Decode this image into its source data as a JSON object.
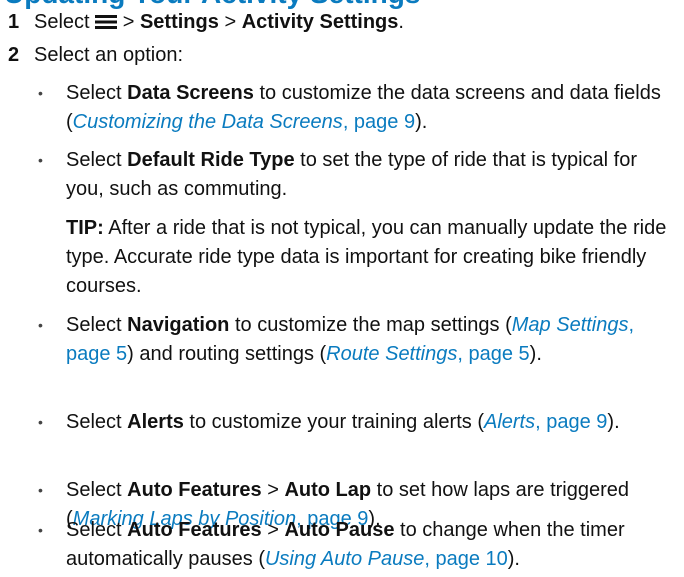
{
  "heading": "Updating Your Activity Settings",
  "step1": {
    "num": "1",
    "pre": "Select",
    "icon": "menu-icon",
    "sep1": ">",
    "settings": "Settings",
    "sep2": ">",
    "activity_settings": "Activity Settings",
    "end": "."
  },
  "step2": {
    "num": "2",
    "text": "Select an option:"
  },
  "bullets": {
    "data_screens": {
      "pre": "Select",
      "term": "Data Screens",
      "mid": "to customize the data screens and data fields (",
      "link_title": "Customizing the Data Screens",
      "link_page": ", page 9",
      "end": ")."
    },
    "ride_type": {
      "pre": "Select",
      "term": "Default Ride Type",
      "mid": "to set the type of ride that is typical for you, such as commuting."
    },
    "tip": {
      "label": "TIP:",
      "text": "After a ride that is not typical, you can manually update the ride type. Accurate ride type data is important for creating bike friendly courses."
    },
    "navigation": {
      "pre": "Select",
      "term": "Navigation",
      "mid": "to customize the map settings (",
      "link1_title": "Map Settings",
      "link1_page": ", page 5",
      "mid2": ") and routing settings (",
      "link2_title": "Route Settings",
      "link2_page": ", page 5",
      "end": ")."
    },
    "alerts": {
      "pre": "Select",
      "term": "Alerts",
      "mid": "to customize your training alerts (",
      "link_title": "Alerts",
      "link_page": ", page 9",
      "end": ")."
    },
    "auto_lap": {
      "pre": "Select",
      "term1": "Auto Features",
      "sep": ">",
      "term2": "Auto Lap",
      "mid": "to set how laps are triggered (",
      "link_title": "Marking Laps by Position",
      "link_page": ", page 9",
      "end": ")."
    },
    "auto_pause": {
      "pre": "Select",
      "term1": "Auto Features",
      "sep": ">",
      "term2": "Auto Pause",
      "mid": "to change when the timer automatically pauses (",
      "link_title": "Using Auto Pause",
      "link_page": ", page 10",
      "end": ")."
    }
  },
  "bullet_char": "•",
  "colors": {
    "link": "#0a7bbf",
    "text": "#111111"
  }
}
